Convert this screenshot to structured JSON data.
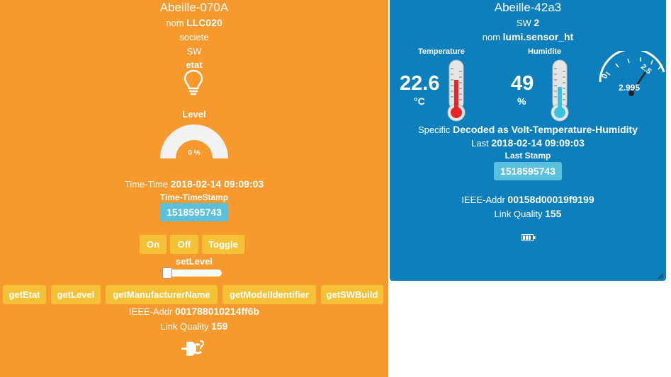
{
  "left": {
    "title": "Abeille-070A",
    "nom_label": "nom",
    "nom_value": "LLC020",
    "societe_label": "societe",
    "sw_label": "SW",
    "etat_label": "etat",
    "etat_icon": "lightbulb-icon",
    "level_label": "Level",
    "level_value": "0 %",
    "level_fraction": 0,
    "time_label": "Time-Time",
    "time_value": "2018-02-14 09:09:03",
    "timestamp_label": "Time-TimeStamp",
    "timestamp_value": "1518595743",
    "buttons": {
      "on": "On",
      "off": "Off",
      "toggle": "Toggle"
    },
    "setlevel_label": "setLevel",
    "setlevel_value": 0,
    "get_buttons": [
      "getEtat",
      "getLevel",
      "getManufacturerName",
      "getModelIdentifier",
      "getSWBuild"
    ],
    "ieee_label": "IEEE-Addr",
    "ieee_value": "001788010214ff6b",
    "link_label": "Link Quality",
    "link_value": "159",
    "power_icon": "plug-unknown-icon",
    "colors": {
      "background": "#f7992d",
      "button": "#f4c137",
      "stamp": "#5bc0de"
    }
  },
  "right": {
    "title": "Abeille-42a3",
    "sw_label": "SW",
    "sw_value": "2",
    "nom_label": "nom",
    "nom_value": "lumi.sensor_ht",
    "temperature_label": "Temperature",
    "temperature_value": "22.6",
    "temperature_unit": "°C",
    "humidity_label": "Humidite",
    "humidity_value": "49",
    "humidity_unit": "%",
    "gauge_value": "2.995",
    "gauge_ticks": [
      "0",
      "2.5"
    ],
    "specific_label": "Specific",
    "specific_value": "Decoded as Volt-Temperature-Humidity",
    "last_label": "Last",
    "last_value": "2018-02-14 09:09:03",
    "last_stamp_label": "Last Stamp",
    "last_stamp_value": "1518595743",
    "ieee_label": "IEEE-Addr",
    "ieee_value": "00158d00019f9199",
    "link_label": "Link Quality",
    "link_value": "155",
    "battery_icon": "battery-full-icon",
    "thermometer_icons": [
      "thermometer-red-icon",
      "thermometer-cyan-icon"
    ],
    "colors": {
      "background": "#0d7fbd",
      "temp_fluid": "#e8262a",
      "hum_fluid": "#39c3e0"
    }
  }
}
